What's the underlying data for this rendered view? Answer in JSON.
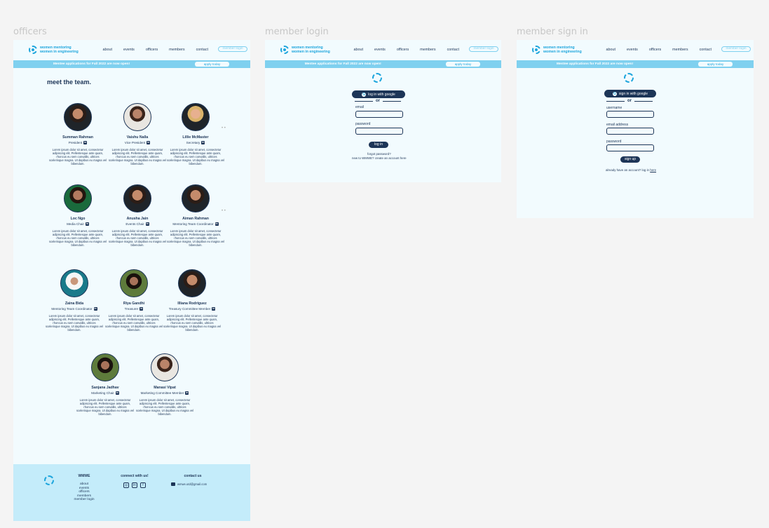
{
  "frames": {
    "officers": "officers",
    "member_login": "member login",
    "member_sign_in": "member sign in"
  },
  "nav": {
    "brand": [
      "women mentoring",
      "women in engineering"
    ],
    "links": [
      "about",
      "events",
      "officers",
      "members",
      "contact"
    ],
    "member_login": "member login"
  },
  "banner": {
    "text": "Mentee applications for Fall 2022 are now open!",
    "apply": "apply today"
  },
  "team": {
    "title": "meet the team.",
    "bio": "Lorem ipsum dolor sit amet, consectetur adipiscing elit. Pellentesque ante quam, rhoncus eu sem convallis, ultrices scelerisque magna. Ut dapibus eu magna vel bibendum.",
    "officers": [
      {
        "name": "Summan Rahman",
        "role": "President"
      },
      {
        "name": "Vaishu Nalla",
        "role": "Vice President"
      },
      {
        "name": "Lillie McMaster",
        "role": "Secretary"
      },
      {
        "name": "Loc Ngo",
        "role": "Media Chair"
      },
      {
        "name": "Anusha Jain",
        "role": "Events Chair"
      },
      {
        "name": "Aiman Rahman",
        "role": "Mentoring Team Coordinator"
      },
      {
        "name": "Zaina Bida",
        "role": "Mentoring Team Coordinator"
      },
      {
        "name": "Riya Gandhi",
        "role": "Treasurer"
      },
      {
        "name": "Illiana Rodriguez",
        "role": "Treasury Committee Member"
      },
      {
        "name": "Sanjana Jadhav",
        "role": "Marketing Chair"
      },
      {
        "name": "Manasi Vipat",
        "role": "Marketing Committee Member"
      }
    ]
  },
  "footer": {
    "wmwe": "WMWE",
    "links": [
      "about",
      "events",
      "officers",
      "members",
      "member login"
    ],
    "connect": "connect with us!",
    "contact": "contact us",
    "email": "wmwe.utd@gmail.com"
  },
  "login": {
    "google": "log in with google",
    "or": "or",
    "email": "email",
    "password": "password",
    "button": "log in",
    "forgot": "forgot password?",
    "new": "new to WMWE? create an account here"
  },
  "signin": {
    "google": "sign in with google",
    "or": "or",
    "username": "username",
    "email": "email address",
    "password": "password",
    "button": "sign up",
    "already": "already have an account? log in ",
    "here": "here"
  },
  "colors": {
    "navy": "#1d3557",
    "accent": "#1fa6dd",
    "banner": "#7fd0ef",
    "page": "#f2fbfe",
    "footer": "#c4ecfa"
  }
}
